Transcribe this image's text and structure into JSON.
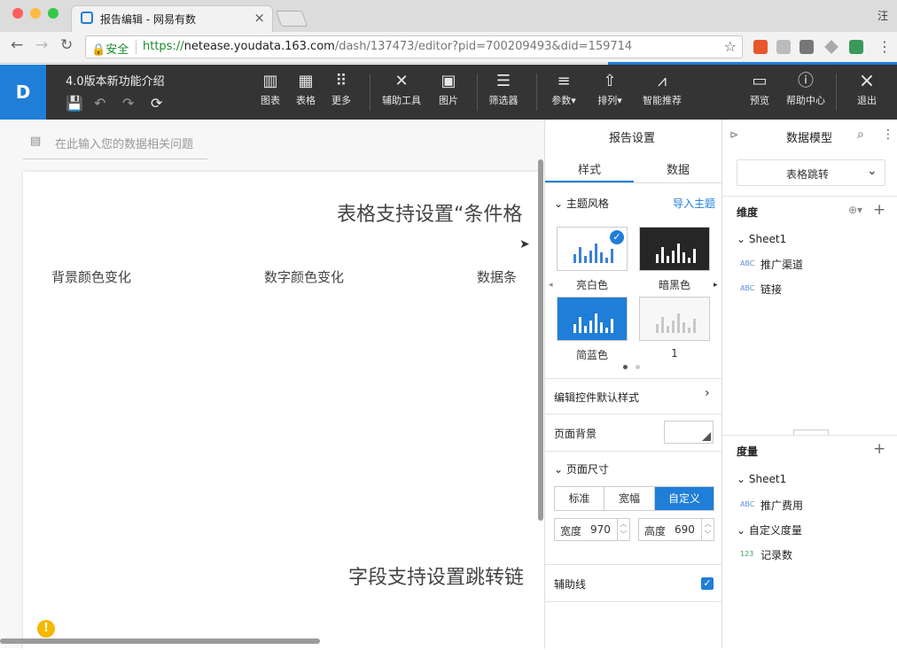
{
  "browser": {
    "tab_title": "报告编辑 - 网易有数",
    "tab_close": "×",
    "user": "汪",
    "secure_label": "安全",
    "url_scheme": "https://",
    "url_host": "netease.youdata.163.com",
    "url_path": "/dash/137473/editor?pid=700209493&did=159714",
    "star": "☆",
    "menu": "⋮"
  },
  "header": {
    "logo": "D",
    "doc_title": "4.0版本新功能介绍",
    "tools": [
      {
        "label": "图表",
        "icon": "chart-icon"
      },
      {
        "label": "表格",
        "icon": "table-icon"
      },
      {
        "label": "更多",
        "icon": "grid-icon"
      },
      {
        "label": "辅助工具",
        "icon": "tools-icon"
      },
      {
        "label": "图片",
        "icon": "image-icon"
      },
      {
        "label": "筛选器",
        "icon": "filter-icon"
      },
      {
        "label": "参数▾",
        "icon": "sliders-icon"
      },
      {
        "label": "排列▾",
        "icon": "arrange-icon"
      },
      {
        "label": "智能推荐",
        "icon": "smart-icon"
      },
      {
        "label": "预览",
        "icon": "preview-icon"
      },
      {
        "label": "帮助中心",
        "icon": "help-icon"
      },
      {
        "label": "退出",
        "icon": "close-icon"
      }
    ]
  },
  "canvas": {
    "question_placeholder": "在此输入您的数据相关问题",
    "heading1": "表格支持设置“条件格",
    "subheads": [
      "背景颜色变化",
      "数字颜色变化",
      "数据条"
    ],
    "heading2": "字段支持设置跳转链",
    "warning": "!"
  },
  "settings": {
    "title": "报告设置",
    "tabs": [
      "样式",
      "数据"
    ],
    "theme_section": "主题风格",
    "import_theme": "导入主题",
    "themes": [
      {
        "label": "亮白色",
        "bg": "#ffffff",
        "bar": "#3b82d6",
        "selected": true
      },
      {
        "label": "暗黑色",
        "bg": "#262626",
        "bar": "#ffffff",
        "selected": false
      },
      {
        "label": "简蓝色",
        "bg": "#1f7ed8",
        "bar": "#ffffff",
        "selected": false
      },
      {
        "label": "1",
        "bg": "#f7f7f7",
        "bar": "#c8c8c8",
        "selected": false
      }
    ],
    "edit_default": "编辑控件默认样式",
    "page_bg": "页面背景",
    "page_size": "页面尺寸",
    "size_options": [
      "标准",
      "宽幅",
      "自定义"
    ],
    "size_selected": "自定义",
    "width_label": "宽度",
    "width_value": "970",
    "height_label": "高度",
    "height_value": "690",
    "guides": "辅助线",
    "guides_checked": true
  },
  "model": {
    "title": "数据模型",
    "dataset": "表格跳转",
    "dimension_title": "维度",
    "dimension_sheet": "Sheet1",
    "dimension_fields": [
      {
        "type": "ABC",
        "name": "推广渠道"
      },
      {
        "type": "ABC",
        "name": "链接"
      }
    ],
    "measure_title": "度量",
    "measure_sheet": "Sheet1",
    "measure_fields": [
      {
        "type": "ABC",
        "name": "推广费用"
      }
    ],
    "custom_measure_group": "自定义度量",
    "custom_fields": [
      {
        "type": "123",
        "name": "记录数"
      }
    ]
  },
  "colors": {
    "accent": "#1f7ed8",
    "appbar": "#343434"
  }
}
